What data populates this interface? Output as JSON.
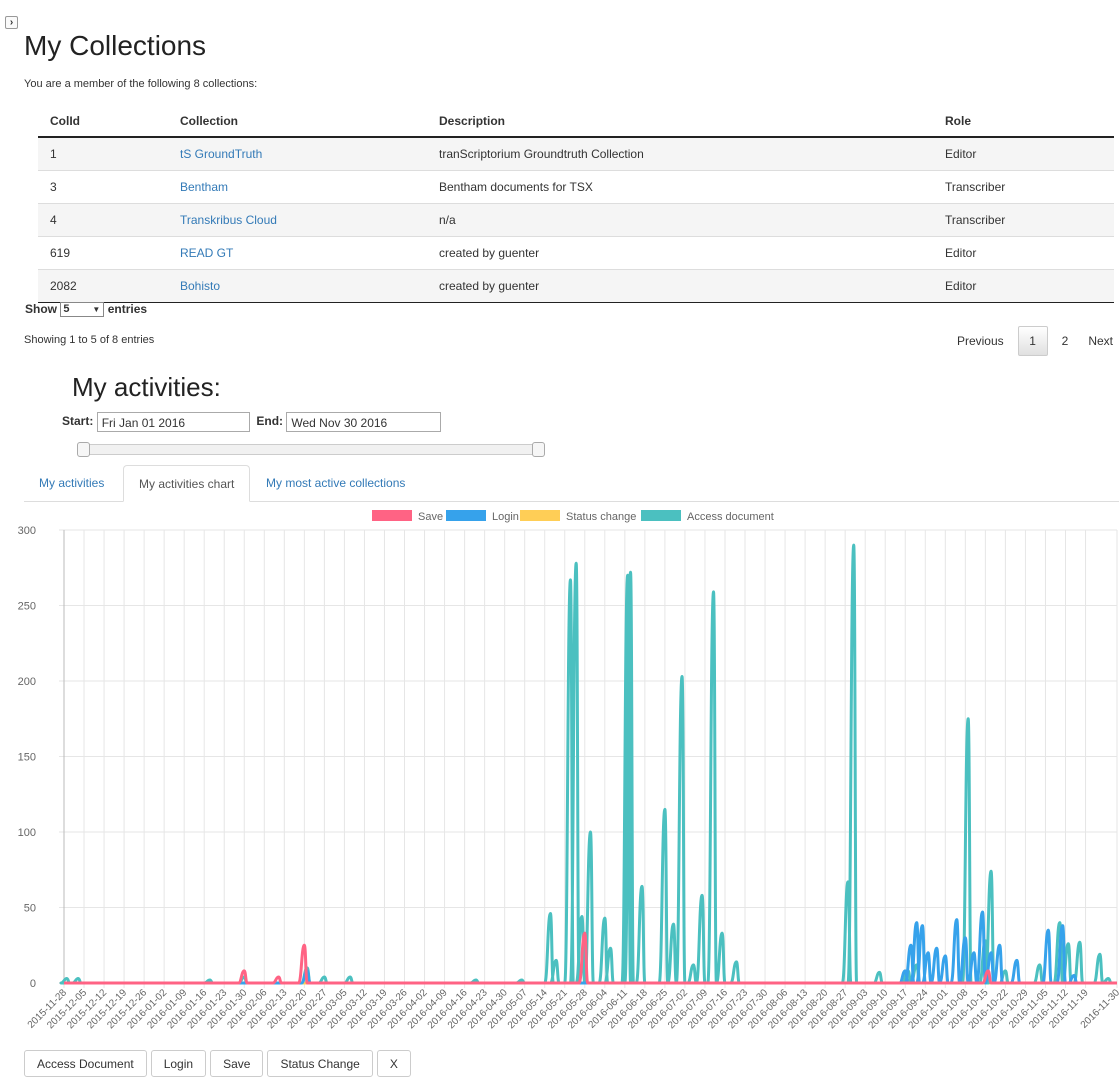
{
  "toggle": {
    "label": "›"
  },
  "page": {
    "title": "My Collections",
    "subtitle": "You are a member of the following 8 collections:"
  },
  "table": {
    "headers": [
      "ColId",
      "Collection",
      "Description",
      "Role"
    ],
    "rows": [
      {
        "id": "1",
        "collection": "tS GroundTruth",
        "description": "tranScriptorium Groundtruth Collection",
        "role": "Editor"
      },
      {
        "id": "3",
        "collection": "Bentham",
        "description": "Bentham documents for TSX",
        "role": "Transcriber"
      },
      {
        "id": "4",
        "collection": "Transkribus Cloud",
        "description": "n/a",
        "role": "Transcriber"
      },
      {
        "id": "619",
        "collection": "READ GT",
        "description": "created by guenter",
        "role": "Editor"
      },
      {
        "id": "2082",
        "collection": "Bohisto",
        "description": "created by guenter",
        "role": "Editor"
      }
    ],
    "show_label": "Show",
    "entries_label": "entries",
    "page_size": "5",
    "showing_text": "Showing 1 to 5 of 8 entries"
  },
  "pagination": {
    "previous": "Previous",
    "current": "1",
    "next_page": "2",
    "next": "Next"
  },
  "activities": {
    "title": "My activities:",
    "start_label": "Start:",
    "start_value": "Fri Jan 01 2016",
    "end_label": "End:",
    "end_value": "Wed Nov 30 2016",
    "range_slider": {
      "start_fraction": 0.0,
      "end_fraction": 1.0
    }
  },
  "tabs": [
    {
      "label": "My activities",
      "active": false
    },
    {
      "label": "My activities chart",
      "active": true
    },
    {
      "label": "My most active collections",
      "active": false
    }
  ],
  "buttons": [
    "Access Document",
    "Login",
    "Save",
    "Status Change",
    "X"
  ],
  "chart_data": {
    "type": "line",
    "ylim": [
      0,
      300
    ],
    "yticks": [
      0,
      50,
      100,
      150,
      200,
      250,
      300
    ],
    "x_start": "2015-11-28",
    "x_end": "2016-11-30",
    "x_tick_labels": [
      "2015-11-28",
      "2015-12-05",
      "2015-12-12",
      "2015-12-19",
      "2015-12-26",
      "2016-01-02",
      "2016-01-09",
      "2016-01-16",
      "2016-01-23",
      "2016-01-30",
      "2016-02-06",
      "2016-02-13",
      "2016-02-20",
      "2016-02-27",
      "2016-03-05",
      "2016-03-12",
      "2016-03-19",
      "2016-03-26",
      "2016-04-02",
      "2016-04-09",
      "2016-04-16",
      "2016-04-23",
      "2016-04-30",
      "2016-05-07",
      "2016-05-14",
      "2016-05-21",
      "2016-05-28",
      "2016-06-04",
      "2016-06-11",
      "2016-06-18",
      "2016-06-25",
      "2016-07-02",
      "2016-07-09",
      "2016-07-16",
      "2016-07-23",
      "2016-07-30",
      "2016-08-06",
      "2016-08-13",
      "2016-08-20",
      "2016-08-27",
      "2016-09-03",
      "2016-09-10",
      "2016-09-17",
      "2016-09-24",
      "2016-10-01",
      "2016-10-08",
      "2016-10-15",
      "2016-10-22",
      "2016-10-29",
      "2016-11-05",
      "2016-11-12",
      "2016-11-19",
      "2016-11-30"
    ],
    "grid": true,
    "legend_position": "top-center",
    "series": [
      {
        "name": "Save",
        "color": "#ff6384",
        "peaks": [
          [
            "2016-01-30",
            8
          ],
          [
            "2016-02-11",
            4
          ],
          [
            "2016-02-20",
            25
          ],
          [
            "2016-05-28",
            33
          ],
          [
            "2016-10-16",
            8
          ]
        ]
      },
      {
        "name": "Login",
        "color": "#36a2eb",
        "peaks": [
          [
            "2016-02-21",
            8
          ],
          [
            "2016-09-17",
            8
          ],
          [
            "2016-09-19",
            25
          ],
          [
            "2016-09-21",
            40
          ],
          [
            "2016-09-23",
            38
          ],
          [
            "2016-09-25",
            20
          ],
          [
            "2016-09-28",
            23
          ],
          [
            "2016-10-01",
            18
          ],
          [
            "2016-10-05",
            42
          ],
          [
            "2016-10-08",
            30
          ],
          [
            "2016-10-11",
            20
          ],
          [
            "2016-10-14",
            47
          ],
          [
            "2016-10-17",
            20
          ],
          [
            "2016-10-20",
            25
          ],
          [
            "2016-10-26",
            15
          ],
          [
            "2016-11-06",
            35
          ],
          [
            "2016-11-11",
            38
          ],
          [
            "2016-11-15",
            5
          ]
        ]
      },
      {
        "name": "Status change",
        "color": "#ffce56",
        "peaks": []
      },
      {
        "name": "Access document",
        "color": "#4bc0c0",
        "peaks": [
          [
            "2015-11-29",
            3
          ],
          [
            "2015-12-03",
            3
          ],
          [
            "2016-01-18",
            2
          ],
          [
            "2016-01-30",
            4
          ],
          [
            "2016-02-21",
            10
          ],
          [
            "2016-02-27",
            4
          ],
          [
            "2016-03-07",
            4
          ],
          [
            "2016-04-20",
            2
          ],
          [
            "2016-05-06",
            2
          ],
          [
            "2016-05-16",
            46
          ],
          [
            "2016-05-18",
            15
          ],
          [
            "2016-05-23",
            267
          ],
          [
            "2016-05-25",
            278
          ],
          [
            "2016-05-27",
            44
          ],
          [
            "2016-05-30",
            100
          ],
          [
            "2016-06-04",
            43
          ],
          [
            "2016-06-06",
            23
          ],
          [
            "2016-06-12",
            270
          ],
          [
            "2016-06-13",
            272
          ],
          [
            "2016-06-17",
            64
          ],
          [
            "2016-06-25",
            115
          ],
          [
            "2016-06-28",
            39
          ],
          [
            "2016-07-01",
            203
          ],
          [
            "2016-07-05",
            12
          ],
          [
            "2016-07-08",
            58
          ],
          [
            "2016-07-12",
            259
          ],
          [
            "2016-07-15",
            33
          ],
          [
            "2016-07-20",
            14
          ],
          [
            "2016-08-28",
            67
          ],
          [
            "2016-08-30",
            290
          ],
          [
            "2016-09-08",
            7
          ],
          [
            "2016-09-18",
            8
          ],
          [
            "2016-09-21",
            12
          ],
          [
            "2016-10-09",
            175
          ],
          [
            "2016-10-15",
            28
          ],
          [
            "2016-10-17",
            74
          ],
          [
            "2016-10-22",
            8
          ],
          [
            "2016-11-03",
            12
          ],
          [
            "2016-11-10",
            40
          ],
          [
            "2016-11-13",
            26
          ],
          [
            "2016-11-17",
            27
          ],
          [
            "2016-11-24",
            19
          ],
          [
            "2016-11-27",
            3
          ]
        ]
      }
    ]
  }
}
